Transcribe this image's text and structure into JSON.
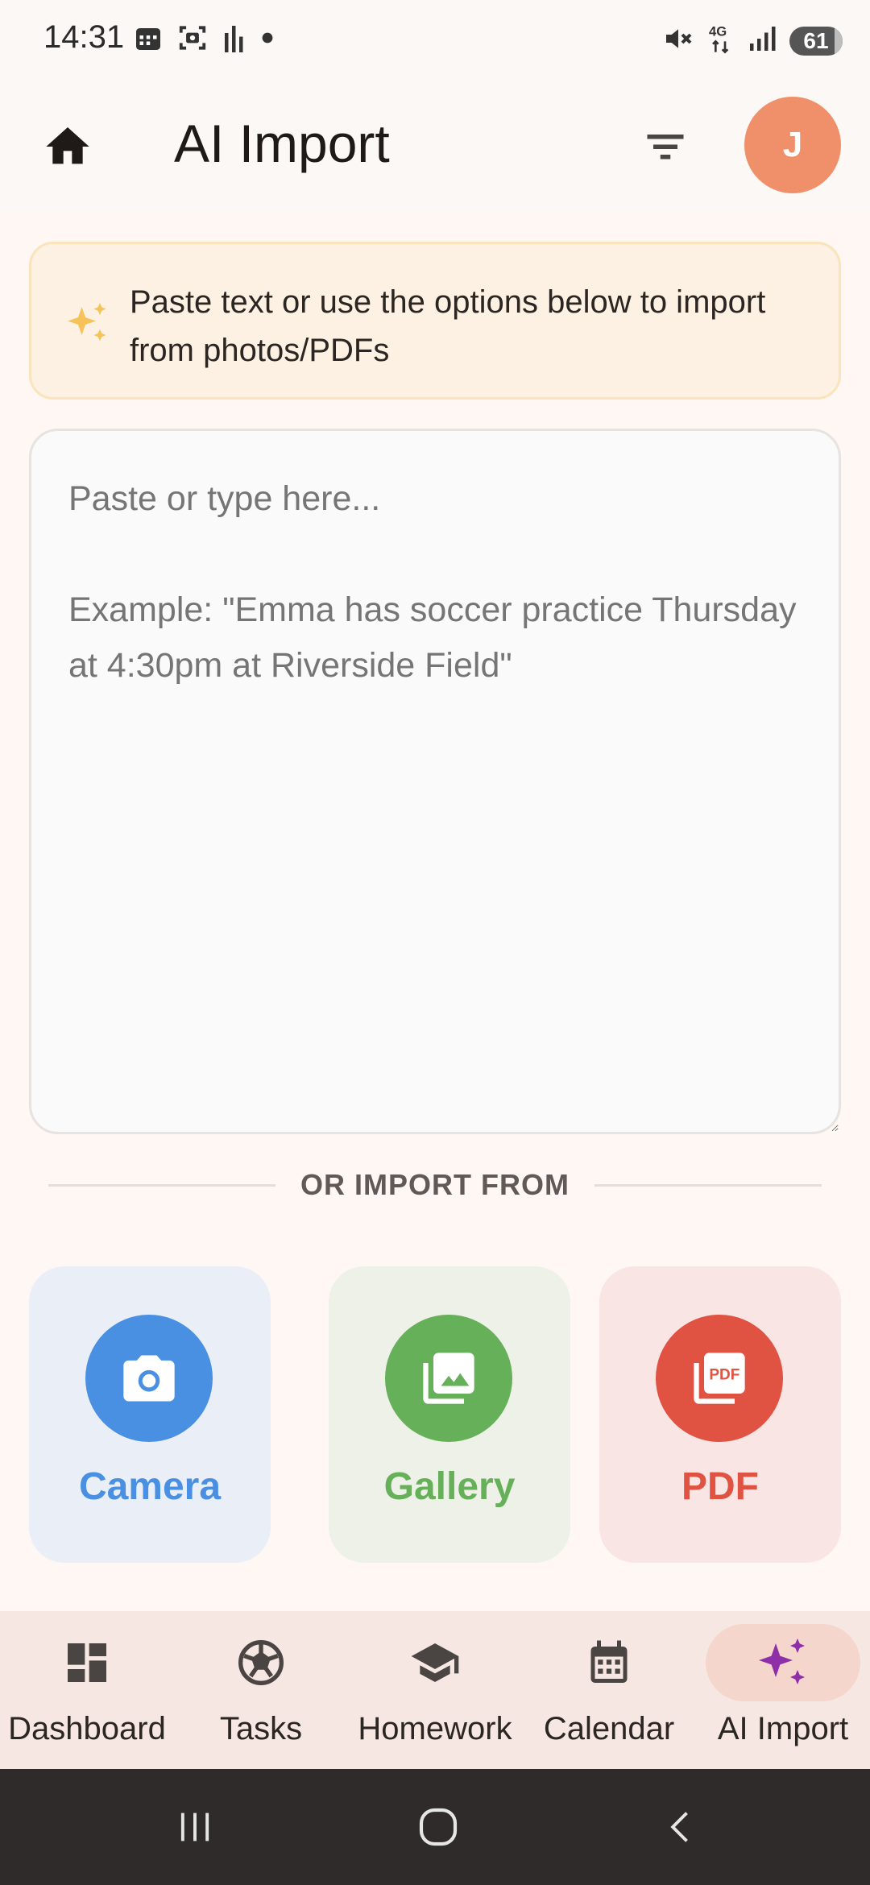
{
  "status_bar": {
    "time": "14:31",
    "left_icons": [
      "calendar-icon",
      "screenshot-icon",
      "audio-bars-icon",
      "dot-icon"
    ],
    "right_icons": [
      "mute-icon",
      "network-4g-icon",
      "signal-icon"
    ],
    "battery": "61"
  },
  "app_bar": {
    "title": "AI Import",
    "home_icon": "home-icon",
    "filter_icon": "filter-icon",
    "avatar_initial": "J",
    "avatar_color": "#F0906A"
  },
  "info_banner": {
    "text": "Paste text or use the options below to import from photos/PDFs",
    "icon": "sparkle-icon"
  },
  "input": {
    "placeholder": "Paste or type here...\n\nExample: \"Emma has soccer practice Thursday at 4:30pm at Riverside Field\"",
    "value": ""
  },
  "divider": {
    "label": "OR IMPORT FROM"
  },
  "import_options": [
    {
      "label": "Camera",
      "icon": "camera-icon",
      "color": "#4A90E2"
    },
    {
      "label": "Gallery",
      "icon": "gallery-icon",
      "color": "#67B05A"
    },
    {
      "label": "PDF",
      "icon": "pdf-icon",
      "color": "#E05242"
    }
  ],
  "bottom_nav": {
    "items": [
      {
        "label": "Dashboard",
        "icon": "dashboard-icon"
      },
      {
        "label": "Tasks",
        "icon": "soccer-ball-icon"
      },
      {
        "label": "Homework",
        "icon": "graduation-cap-icon"
      },
      {
        "label": "Calendar",
        "icon": "calendar-icon"
      },
      {
        "label": "AI Import",
        "icon": "sparkle-icon",
        "active": true
      }
    ]
  },
  "system_nav": {
    "buttons": [
      "recents-icon",
      "home-circle-icon",
      "back-icon"
    ]
  }
}
